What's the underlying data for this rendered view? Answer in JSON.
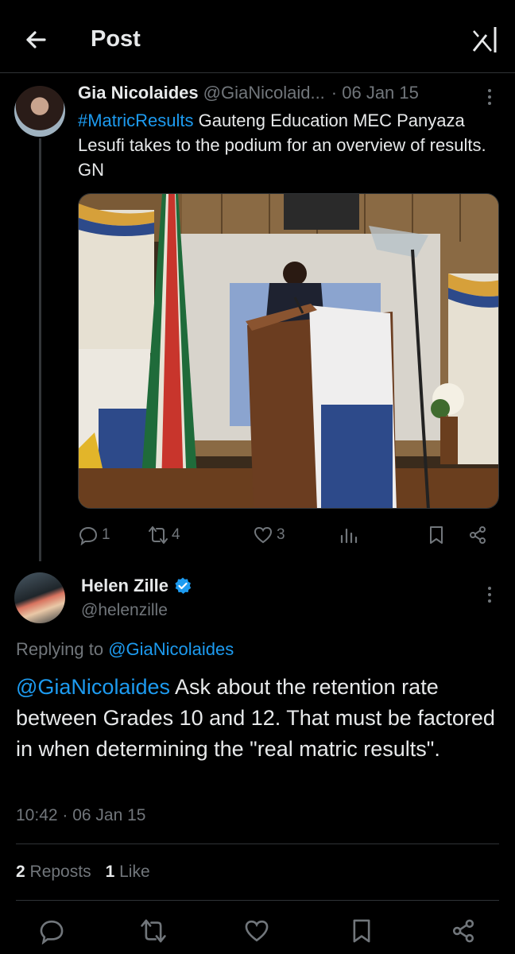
{
  "header": {
    "title": "Post",
    "back_icon": "arrow-left-icon",
    "grok_icon": "grok-icon"
  },
  "post1": {
    "author_name": "Gia Nicolaides",
    "author_handle": "@GiaNicolaid...",
    "date": "· 06 Jan 15",
    "hashtag": "#MatricResults",
    "text": " Gauteng Education MEC Panyaza Lesufi takes to the podium for an overview of results. GN",
    "replies": "1",
    "reposts": "4",
    "likes": "3"
  },
  "post2": {
    "author_name": "Helen Zille",
    "author_handle": "@helenzille",
    "replying_prefix": "Replying to ",
    "replying_to": "@GiaNicolaides",
    "mention": "@GiaNicolaides",
    "text": " Ask about the retention rate between Grades 10 and 12.  That must be factored in when determining the \"real matric results\".",
    "timestamp": "10:42 · 06 Jan 15",
    "reposts_count": "2",
    "reposts_label": "Reposts",
    "likes_count": "1",
    "likes_label": "Like"
  },
  "colors": {
    "accent": "#1d9bf0",
    "muted": "#71767b",
    "text": "#e7e9ea",
    "background": "#000000"
  }
}
